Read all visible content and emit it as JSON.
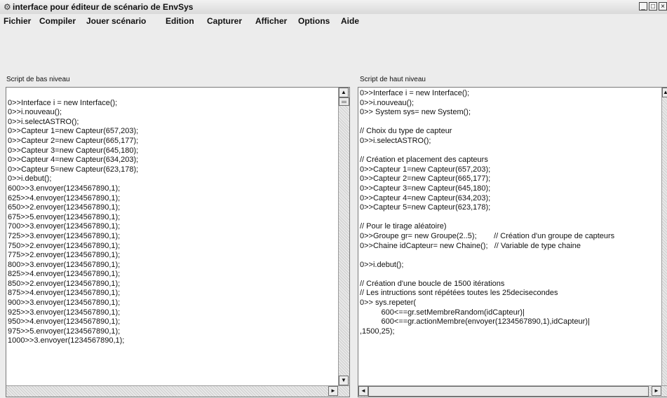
{
  "window": {
    "title": "interface pour éditeur de scénario de EnvSys",
    "minimize": "_",
    "maximize": "□",
    "close": "×"
  },
  "menu": [
    "Fichier",
    "Compiler",
    "Jouer scénario",
    "Edition",
    "Capturer",
    "Afficher",
    "Options",
    "Aide"
  ],
  "left_panel": {
    "label": "Script de bas niveau",
    "text": "\n0>>Interface i = new Interface();\n0>>i.nouveau();\n0>>i.selectASTRO();\n0>>Capteur 1=new Capteur(657,203);\n0>>Capteur 2=new Capteur(665,177);\n0>>Capteur 3=new Capteur(645,180);\n0>>Capteur 4=new Capteur(634,203);\n0>>Capteur 5=new Capteur(623,178);\n0>>i.debut();\n600>>3.envoyer(1234567890,1);\n625>>4.envoyer(1234567890,1);\n650>>2.envoyer(1234567890,1);\n675>>5.envoyer(1234567890,1);\n700>>3.envoyer(1234567890,1);\n725>>3.envoyer(1234567890,1);\n750>>2.envoyer(1234567890,1);\n775>>2.envoyer(1234567890,1);\n800>>3.envoyer(1234567890,1);\n825>>4.envoyer(1234567890,1);\n850>>2.envoyer(1234567890,1);\n875>>4.envoyer(1234567890,1);\n900>>3.envoyer(1234567890,1);\n925>>3.envoyer(1234567890,1);\n950>>4.envoyer(1234567890,1);\n975>>5.envoyer(1234567890,1);\n1000>>3.envoyer(1234567890,1);"
  },
  "right_panel": {
    "label": "Script de haut niveau",
    "text": "0>>Interface i = new Interface();\n0>>i.nouveau();\n0>> System sys= new System();\n\n// Choix du type de capteur\n0>>i.selectASTRO();\n\n// Création et placement des capteurs\n0>>Capteur 1=new Capteur(657,203);\n0>>Capteur 2=new Capteur(665,177);\n0>>Capteur 3=new Capteur(645,180);\n0>>Capteur 4=new Capteur(634,203);\n0>>Capteur 5=new Capteur(623,178);\n\n// Pour le tirage aléatoire)\n0>>Groupe gr= new Groupe(2..5);        // Création d'un groupe de capteurs\n0>>Chaine idCapteur= new Chaine();   // Variable de type chaine\n\n0>>i.debut();\n\n// Création d'une boucle de 1500 itérations\n// Les intructions sont répétées toutes les 25decisecondes\n0>> sys.repeter(\n          600<==gr.setMembreRandom(idCapteur)|\n          600<==gr.actionMembre(envoyer(1234567890,1),idCapteur)|\n,1500,25);"
  },
  "scroll": {
    "up": "▲",
    "down": "▼",
    "left": "◄",
    "right": "►"
  }
}
